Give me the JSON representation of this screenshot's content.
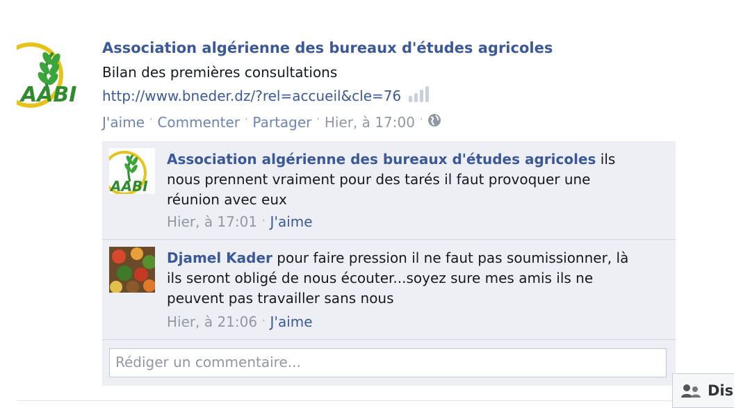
{
  "post": {
    "author": "Association algérienne des bureaux d'études agricoles",
    "text": "Bilan des premières consultations",
    "link": "http://www.bneder.dz/?rel=accueil&cle=76",
    "actions": {
      "like": "J'aime",
      "comment": "Commenter",
      "share": "Partager",
      "time": "Hier, à 17:00"
    },
    "logo_text": "AABI"
  },
  "comments": [
    {
      "author": "Association algérienne des bureaux d'études agricoles",
      "text": " ils nous prennent vraiment pour des tarés il faut provoquer une réunion avec eux",
      "time": "Hier, à 17:01",
      "like": "J'aime"
    },
    {
      "author": "Djamel Kader",
      "text": " pour faire pression il ne faut pas soumissionner, là ils seront obligé de nous écouter...soyez sure mes amis ils ne peuvent pas travailler sans nous",
      "time": "Hier, à 21:06",
      "like": "J'aime"
    }
  ],
  "composer": {
    "placeholder": "Rédiger un commentaire..."
  },
  "chat_tab": {
    "label": "Dis"
  },
  "colors": {
    "link": "#3b5998",
    "action": "#6d84b4",
    "muted": "#9197a3",
    "comments_bg": "#edeff4",
    "logo_green": "#2e8b2e",
    "logo_yellow": "#e6c21a"
  }
}
